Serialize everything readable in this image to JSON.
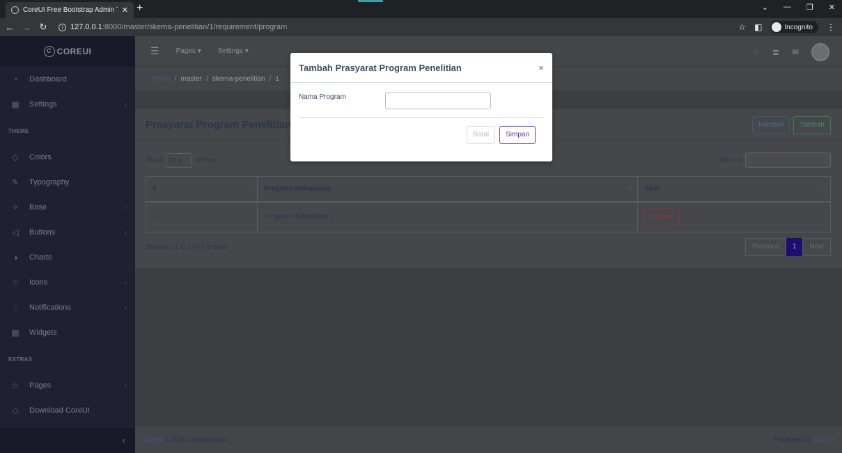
{
  "browser": {
    "tab_title": "CoreUI Free Bootstrap Admin Te",
    "url_host": "127.0.0.1",
    "url_rest": ":8000/master/skema-penelitian/1/requirement/program",
    "incognito_label": "Incognito"
  },
  "sidebar": {
    "brand": "COREUI",
    "items": [
      {
        "label": "Dashboard",
        "icon": "speedometer-icon"
      },
      {
        "label": "Settings",
        "icon": "grid-icon",
        "has_caret": true
      }
    ],
    "section_theme": "THEME",
    "theme_items": [
      {
        "label": "Colors",
        "icon": "drop-icon"
      },
      {
        "label": "Typography",
        "icon": "pencil-icon"
      },
      {
        "label": "Base",
        "icon": "puzzle-icon",
        "has_caret": true
      },
      {
        "label": "Buttons",
        "icon": "cursor-icon",
        "has_caret": true
      },
      {
        "label": "Charts",
        "icon": "chart-pie-icon"
      },
      {
        "label": "Icons",
        "icon": "star-icon",
        "has_caret": true
      },
      {
        "label": "Notifications",
        "icon": "bell-icon",
        "has_caret": true
      },
      {
        "label": "Widgets",
        "icon": "calculator-icon"
      }
    ],
    "section_extras": "EXTRAS",
    "extra_items": [
      {
        "label": "Pages",
        "icon": "star-icon",
        "has_caret": true
      },
      {
        "label": "Download CoreUI",
        "icon": "cloud-download-icon"
      }
    ]
  },
  "header": {
    "nav_pages": "Pages ▾",
    "nav_settings": "Settings ▾"
  },
  "breadcrumb": {
    "home": "Home",
    "master": "master",
    "skema": "skema-penelitian",
    "id": "1"
  },
  "card": {
    "title": "Prasyarat Program Penelitian",
    "kembali": "Kembali",
    "tambah": "Tambah",
    "show": "Show",
    "entries_value": "10 ⇕",
    "entries": "entries",
    "search": "Search:",
    "columns": [
      "#",
      "Program Mahasiswa",
      "Aksi"
    ],
    "rows": [
      {
        "no": "1",
        "program": "Program Mahasiswa 1",
        "action": "Hapus"
      }
    ],
    "info": "Showing 1 to 1 of 1 entries",
    "prev": "Previous",
    "page": "1",
    "next": "Next"
  },
  "footer": {
    "left_link": "CoreUI",
    "left_text": " © 2020 creativeLabs.",
    "right_text": "Powered by ",
    "right_link": "CoreUI"
  },
  "modal": {
    "title": "Tambah Prasyarat Program Penelitian",
    "close": "×",
    "field_label": "Nama Program",
    "field_value": "",
    "field_placeholder": "",
    "batal": "Batal",
    "simpan": "Simpan"
  }
}
